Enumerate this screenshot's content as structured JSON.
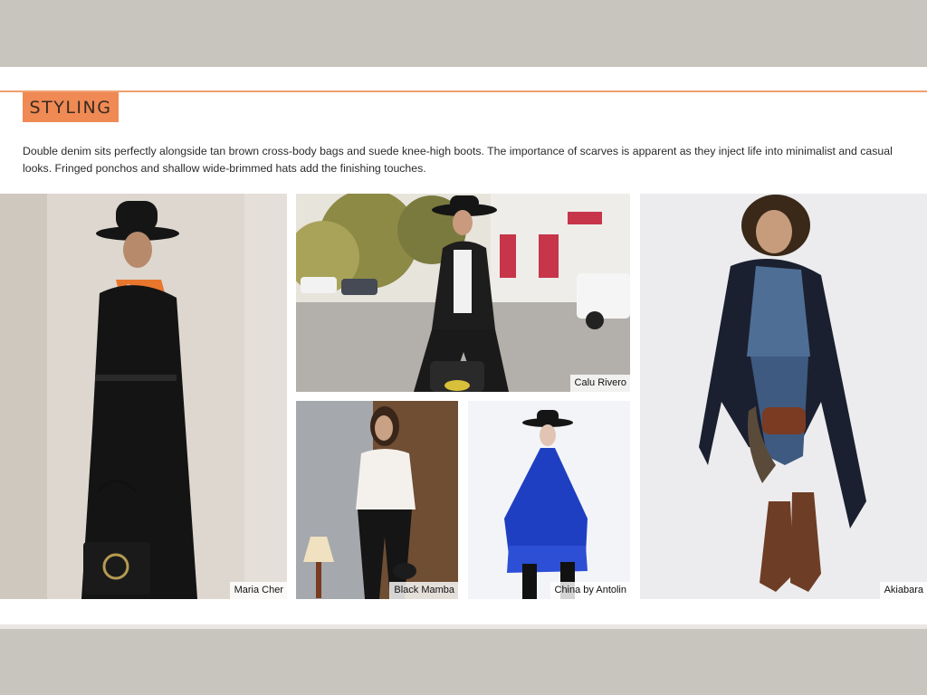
{
  "section": {
    "tag": "STYLING",
    "intro": "Double denim sits perfectly alongside tan brown cross-body bags and suede knee-high boots. The importance of scarves is apparent as they inject life into minimalist and casual looks. Fringed ponchos and shallow wide-brimmed hats add the finishing touches."
  },
  "photos": [
    {
      "caption": "Maria Cher"
    },
    {
      "caption": "Calu Rivero"
    },
    {
      "caption": "Black Mamba"
    },
    {
      "caption": "China by Antolin"
    },
    {
      "caption": "Akiabara"
    }
  ],
  "colors": {
    "accent": "#ef8a54",
    "accent_rule": "#f0a070",
    "frame": "#c8c4be"
  }
}
